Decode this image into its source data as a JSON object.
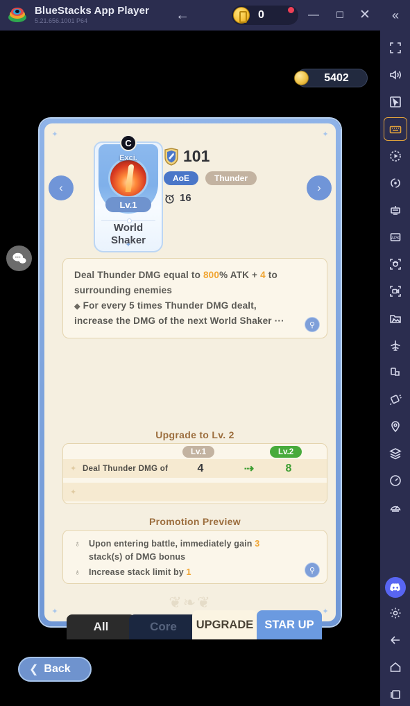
{
  "titlebar": {
    "app_name": "BlueStacks App Player",
    "version": "5.21.656.1001  P64",
    "back_icon": "←",
    "coin_value": "0",
    "minimize_icon": "—",
    "maximize_icon": "☐",
    "close_icon": "✕",
    "collapse_icon": "«"
  },
  "sidebar": {
    "items": [
      {
        "name": "fullscreen-icon"
      },
      {
        "name": "volume-icon"
      },
      {
        "name": "cursor-icon"
      },
      {
        "name": "keymapping-icon",
        "active": true
      },
      {
        "name": "macro-play-icon"
      },
      {
        "name": "rotate-icon"
      },
      {
        "name": "multi-instance-icon"
      },
      {
        "name": "install-apk-icon"
      },
      {
        "name": "screenshot-icon"
      },
      {
        "name": "record-screen-icon"
      },
      {
        "name": "media-manager-icon"
      },
      {
        "name": "eco-mode-icon"
      },
      {
        "name": "shake-icon"
      },
      {
        "name": "tilt-icon"
      },
      {
        "name": "location-icon"
      },
      {
        "name": "layers-icon"
      },
      {
        "name": "trim-memory-icon"
      },
      {
        "name": "performance-icon"
      },
      {
        "name": "discord-icon"
      },
      {
        "name": "settings-icon"
      },
      {
        "name": "android-back-icon"
      },
      {
        "name": "android-home-icon"
      },
      {
        "name": "android-recents-icon"
      }
    ]
  },
  "game": {
    "gold": "5402",
    "chat_icon": "chat-bubble-icon",
    "nav_prev_icon": "‹",
    "nav_next_icon": "›",
    "skill": {
      "rank_badge": "C",
      "rarity_label": "Exci.",
      "level_badge": "Lv.1",
      "name_line1": "World",
      "name_line2": "Shaker",
      "power": "101",
      "tags": [
        "AoE",
        "Thunder"
      ],
      "cooldown": "16"
    },
    "description": {
      "line1_pre": "Deal Thunder DMG equal to ",
      "line1_hl1": "800",
      "line1_mid": "% ATK + ",
      "line1_hl2": "4",
      "line1_post": " to",
      "line2": "surrounding enemies",
      "line3_bullet": "◆",
      "line3": " For every 5 times Thunder DMG dealt,",
      "line4": "increase the DMG of the next World Shaker ···",
      "zoom_icon": "zoom-in-icon"
    },
    "upgrade": {
      "title": "Upgrade to Lv. 2",
      "col_from": "Lv.1",
      "col_to": "Lv.2",
      "arrow": "⇢",
      "rows": [
        {
          "label": "Deal Thunder DMG of",
          "from": "4",
          "to": "8"
        },
        {
          "label": "",
          "from": "",
          "to": ""
        }
      ]
    },
    "promotion": {
      "title": "Promotion Preview",
      "items": [
        {
          "icon": "♁",
          "pre": "Upon entering battle, immediately gain ",
          "hl": "3",
          "post": ""
        },
        {
          "icon": "",
          "pre": "stack(s) of DMG bonus",
          "hl": "",
          "post": ""
        },
        {
          "icon": "♁",
          "pre": "Increase stack limit by ",
          "hl": "1",
          "post": ""
        }
      ],
      "zoom_icon": "zoom-in-icon"
    },
    "tabs": [
      {
        "label": "All",
        "state": "inactive"
      },
      {
        "label": "Core",
        "state": "disabled"
      },
      {
        "label": "UPGRADE",
        "state": "selected"
      },
      {
        "label": "STAR UP",
        "state": "normal"
      }
    ],
    "back_button": {
      "icon": "❮",
      "label": "Back"
    }
  }
}
